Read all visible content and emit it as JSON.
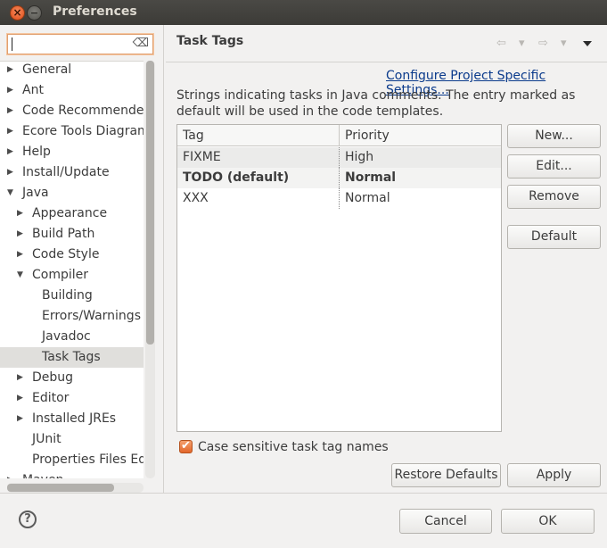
{
  "window": {
    "title": "Preferences",
    "close_glyph": "×",
    "minimize_glyph": "−"
  },
  "filter": {
    "value": "",
    "clear_icon": "clear-icon"
  },
  "tree": {
    "items": [
      {
        "label": "General",
        "level": 0,
        "arrow": "▶"
      },
      {
        "label": "Ant",
        "level": 0,
        "arrow": "▶"
      },
      {
        "label": "Code Recommenders",
        "level": 0,
        "arrow": "▶"
      },
      {
        "label": "Ecore Tools Diagram",
        "level": 0,
        "arrow": "▶"
      },
      {
        "label": "Help",
        "level": 0,
        "arrow": "▶"
      },
      {
        "label": "Install/Update",
        "level": 0,
        "arrow": "▶"
      },
      {
        "label": "Java",
        "level": 0,
        "arrow": "▼"
      },
      {
        "label": "Appearance",
        "level": 1,
        "arrow": "▶"
      },
      {
        "label": "Build Path",
        "level": 1,
        "arrow": "▶"
      },
      {
        "label": "Code Style",
        "level": 1,
        "arrow": "▶"
      },
      {
        "label": "Compiler",
        "level": 1,
        "arrow": "▼"
      },
      {
        "label": "Building",
        "level": 2,
        "arrow": ""
      },
      {
        "label": "Errors/Warnings",
        "level": 2,
        "arrow": ""
      },
      {
        "label": "Javadoc",
        "level": 2,
        "arrow": ""
      },
      {
        "label": "Task Tags",
        "level": 2,
        "arrow": "",
        "selected": true
      },
      {
        "label": "Debug",
        "level": 1,
        "arrow": "▶"
      },
      {
        "label": "Editor",
        "level": 1,
        "arrow": "▶"
      },
      {
        "label": "Installed JREs",
        "level": 1,
        "arrow": "▶"
      },
      {
        "label": "JUnit",
        "level": 1,
        "arrow": ""
      },
      {
        "label": "Properties Files Editor",
        "level": 1,
        "arrow": ""
      },
      {
        "label": "Maven",
        "level": 0,
        "arrow": "▶"
      }
    ]
  },
  "page": {
    "title": "Task Tags",
    "back_glyph": "⇦",
    "forward_glyph": "⇨",
    "dropdown_glyph": "▾",
    "link": "Configure Project Specific Settings...",
    "description": "Strings indicating tasks in Java comments. The entry marked as default will be used in the code templates."
  },
  "table": {
    "columns": [
      "Tag",
      "Priority"
    ],
    "rows": [
      {
        "tag": "FIXME",
        "priority": "High"
      },
      {
        "tag": "TODO (default)",
        "priority": "Normal"
      },
      {
        "tag": "XXX",
        "priority": "Normal"
      }
    ]
  },
  "buttons": {
    "new": "New...",
    "edit": "Edit...",
    "remove": "Remove",
    "default": "Default",
    "restore_defaults": "Restore Defaults",
    "apply": "Apply",
    "cancel": "Cancel",
    "ok": "OK"
  },
  "case_sensitive": {
    "label": "Case sensitive task tag names",
    "checked": true,
    "check_glyph": "✔"
  },
  "help": {
    "glyph": "?"
  }
}
